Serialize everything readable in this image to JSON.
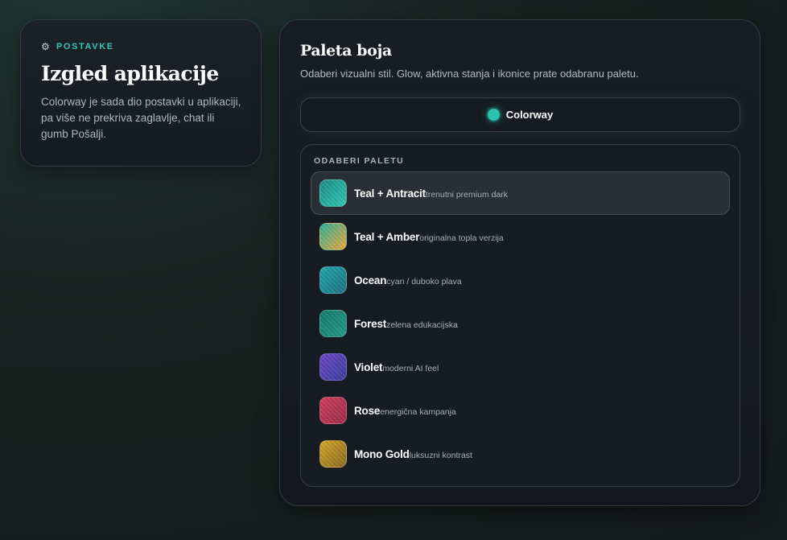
{
  "left_card": {
    "eyebrow": "POSTAVKE",
    "title": "Izgled aplikacije",
    "description": "Colorway je sada dio postavki u aplikaciji, pa više ne prekriva zaglavlje, chat ili gumb Pošalji."
  },
  "right_card": {
    "title": "Paleta boja",
    "subtitle": "Odaberi vizualni stil. Glow, aktivna stanja i ikonice prate odabranu paletu.",
    "toggle_label": "Colorway",
    "accent_color": "#2cc2ae",
    "palette_heading": "ODABERI PALETU",
    "palettes": [
      {
        "name": "Teal + Antracit",
        "desc": "trenutni premium dark",
        "active": true,
        "c1": "#1a8f86",
        "c2": "#2fc7b4"
      },
      {
        "name": "Teal + Amber",
        "desc": "originalna topla verzija",
        "active": false,
        "c1": "#29b39b",
        "c2": "#f2a83a"
      },
      {
        "name": "Ocean",
        "desc": "cyan / duboko plava",
        "active": false,
        "c1": "#1ea8a8",
        "c2": "#1d6f86"
      },
      {
        "name": "Forest",
        "desc": "zelena edukacijska",
        "active": false,
        "c1": "#16796a",
        "c2": "#1f9a85"
      },
      {
        "name": "Violet",
        "desc": "moderni AI feel",
        "active": false,
        "c1": "#6a45c7",
        "c2": "#3a3f9c"
      },
      {
        "name": "Rose",
        "desc": "energična kampanja",
        "active": false,
        "c1": "#d23d5c",
        "c2": "#9c2d4b"
      },
      {
        "name": "Mono Gold",
        "desc": "luksuzni kontrast",
        "active": false,
        "c1": "#d7a72a",
        "c2": "#8a6a1c"
      }
    ]
  }
}
